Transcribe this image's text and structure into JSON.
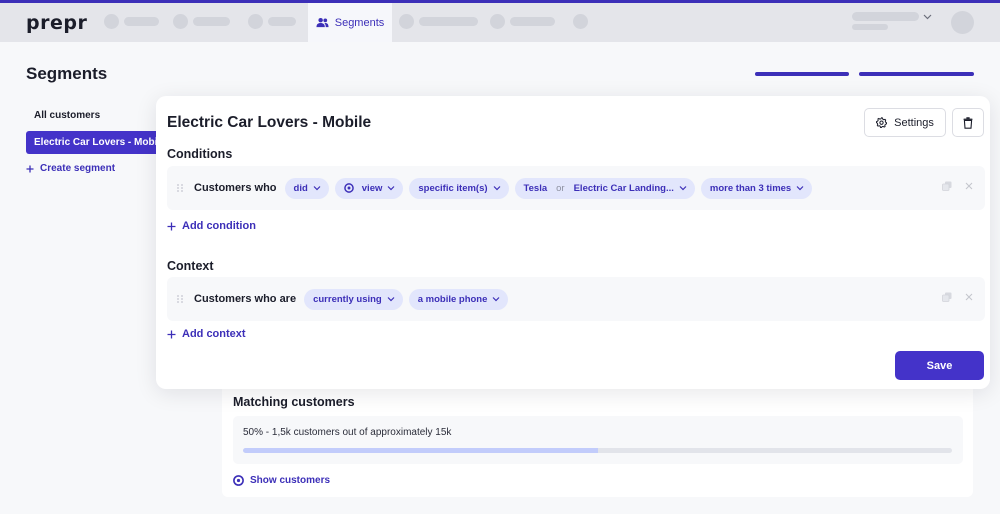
{
  "app": {
    "logo": "prepr",
    "active_tab": "Segments",
    "accent_color": "#3c2fb8"
  },
  "page": {
    "title": "Segments"
  },
  "sidebar": {
    "items": [
      {
        "label": "All customers",
        "active": false
      },
      {
        "label": "Electric Car Lovers - Mobile",
        "active": true
      }
    ],
    "create_label": "Create segment"
  },
  "segment": {
    "title": "Electric Car Lovers - Mobile",
    "settings_label": "Settings",
    "conditions": {
      "title": "Conditions",
      "rows": [
        {
          "label": "Customers who",
          "pills": {
            "action_verb": "did",
            "event": "view",
            "target": "specific item(s)",
            "item_a": "Tesla",
            "or_text": "or",
            "item_b": "Electric Car Landing...",
            "frequency": "more than 3 times"
          }
        }
      ],
      "add_label": "Add condition"
    },
    "context": {
      "title": "Context",
      "rows": [
        {
          "label": "Customers who are",
          "pills": {
            "state": "currently using",
            "device": "a mobile phone"
          }
        }
      ],
      "add_label": "Add context"
    },
    "save_label": "Save"
  },
  "matching": {
    "title": "Matching customers",
    "summary": "50% - 1,5k customers out of approximately 15k",
    "progress_fraction": 0.5,
    "show_label": "Show customers"
  }
}
